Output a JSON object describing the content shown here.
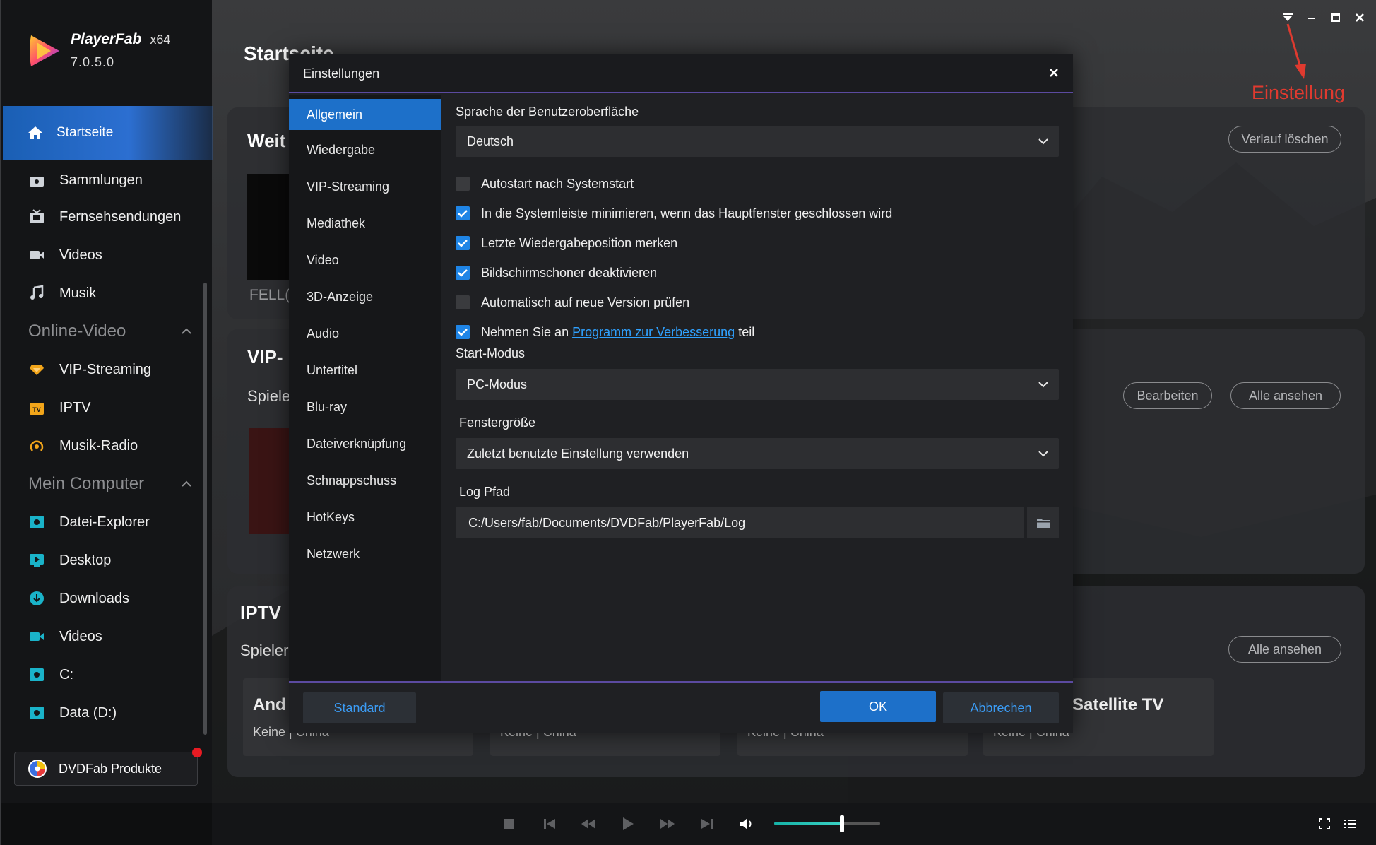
{
  "app": {
    "name": "PlayerFab",
    "arch": "x64",
    "version": "7.0.5.0"
  },
  "sidebar": {
    "home": "Startseite",
    "items": [
      {
        "label": "Sammlungen",
        "icon": "collection-icon"
      },
      {
        "label": "Fernsehsendungen",
        "icon": "tv-icon"
      },
      {
        "label": "Videos",
        "icon": "video-camera-icon"
      },
      {
        "label": "Musik",
        "icon": "music-note-icon"
      }
    ],
    "online_section": "Online-Video",
    "online_items": [
      {
        "label": "VIP-Streaming",
        "icon": "vip-diamond-icon"
      },
      {
        "label": "IPTV",
        "icon": "tv-badge-icon"
      },
      {
        "label": "Musik-Radio",
        "icon": "radio-icon"
      }
    ],
    "computer_section": "Mein Computer",
    "computer_items": [
      {
        "label": "Datei-Explorer",
        "icon": "folder-icon"
      },
      {
        "label": "Desktop",
        "icon": "desktop-icon"
      },
      {
        "label": "Downloads",
        "icon": "download-icon"
      },
      {
        "label": "Videos",
        "icon": "video-icon"
      },
      {
        "label": "C:",
        "icon": "drive-icon"
      },
      {
        "label": "Data (D:)",
        "icon": "drive-icon"
      }
    ],
    "dvdfab_button": "DVDFab Produkte"
  },
  "main": {
    "page_title": "Startseite",
    "continue_title": "Weit",
    "continue_item": "FELL(",
    "clear_history": "Verlauf löschen",
    "vip_title": "VIP-",
    "vip_sub": "Spiele",
    "edit_button": "Bearbeiten",
    "view_all_1": "Alle ansehen",
    "iptv_title": "IPTV",
    "iptv_sub": "Spieler",
    "view_all_2": "Alle ansehen",
    "channels": [
      {
        "title": "And",
        "sub": "Keine | China"
      },
      {
        "title": "",
        "sub": "Keine | China"
      },
      {
        "title": "",
        "sub": "Keine | China"
      },
      {
        "title": "Satellite TV",
        "sub": "Keine | China"
      }
    ]
  },
  "annotation": {
    "text": "Einstellung",
    "color": "#e03a2f"
  },
  "dialog": {
    "title": "Einstellungen",
    "nav": [
      "Allgemein",
      "Wiedergabe",
      "VIP-Streaming",
      "Mediathek",
      "Video",
      "3D-Anzeige",
      "Audio",
      "Untertitel",
      "Blu-ray",
      "Dateiverknüpfung",
      "Schnappschuss",
      "HotKeys",
      "Netzwerk"
    ],
    "active_nav": "Allgemein",
    "language_label": "Sprache der Benutzeroberfläche",
    "language_value": "Deutsch",
    "checks": [
      {
        "label": "Autostart nach Systemstart",
        "checked": false
      },
      {
        "label": "In die Systemleiste minimieren, wenn das Hauptfenster geschlossen wird",
        "checked": true
      },
      {
        "label": "Letzte Wiedergabeposition merken",
        "checked": true
      },
      {
        "label": "Bildschirmschoner deaktivieren",
        "checked": true
      },
      {
        "label": "Automatisch auf neue Version prüfen",
        "checked": false
      }
    ],
    "improve": {
      "prefix": "Nehmen Sie an",
      "link": "Programm zur Verbesserung",
      "suffix": "teil",
      "checked": true
    },
    "start_mode_label": "Start-Modus",
    "start_mode_value": "PC-Modus",
    "window_size_label": "Fenstergröße",
    "window_size_value": "Zuletzt benutzte Einstellung verwenden",
    "log_label": "Log Pfad",
    "log_value": "C:/Users/fab/Documents/DVDFab/PlayerFab/Log",
    "btn_standard": "Standard",
    "btn_ok": "OK",
    "btn_cancel": "Abbrechen"
  },
  "player": {
    "volume": 0.64,
    "accent": "#1d70c9"
  }
}
